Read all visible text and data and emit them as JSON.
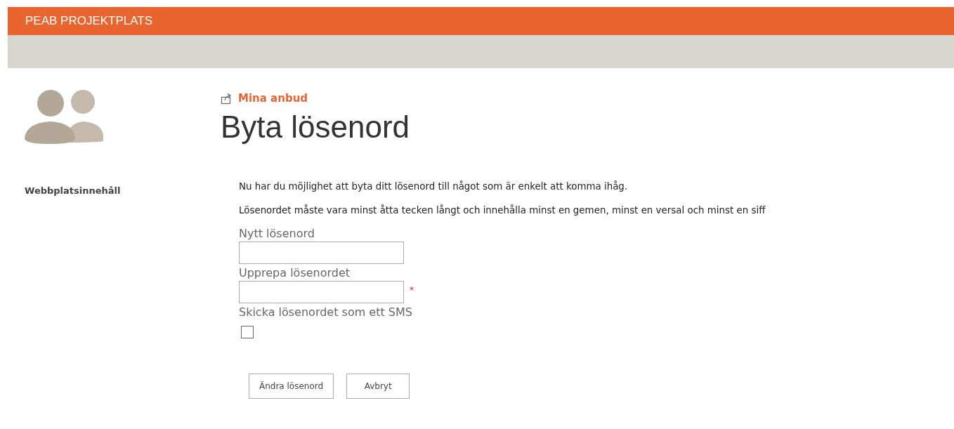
{
  "header": {
    "title": "PEAB PROJEKTPLATS"
  },
  "sidebar": {
    "items": [
      {
        "label": "Webbplatsinnehåll"
      }
    ]
  },
  "breadcrumb": {
    "label": "Mina anbud"
  },
  "page_title": "Byta lösenord",
  "paragraphs": [
    "Nu har du möjlighet att byta ditt lösenord till något som är enkelt att komma ihåg.",
    "Lösenordet måste vara minst åtta tecken långt och innehålla minst en gemen, minst en versal och minst en siff"
  ],
  "fields": [
    {
      "kind": "text",
      "label": "Nytt lösenord"
    },
    {
      "kind": "text",
      "label": "Upprepa lösenordet",
      "required_mark": "*"
    },
    {
      "kind": "checkbox",
      "label": "Skicka lösenordet som ett SMS",
      "checked": false
    }
  ],
  "buttons": [
    "Ändra lösenord",
    "Avbryt"
  ]
}
